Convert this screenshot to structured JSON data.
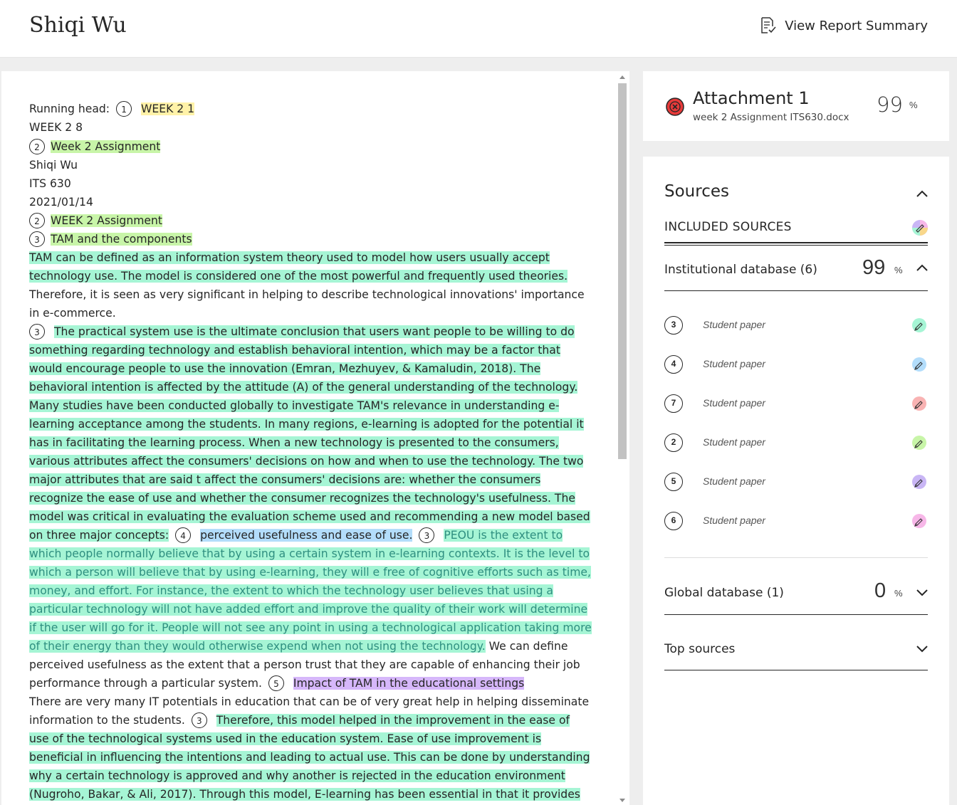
{
  "header": {
    "student_name": "Shiqi Wu",
    "report_button": "View Report Summary"
  },
  "document": {
    "line1_prefix": "Running head:",
    "line1_badge": "1",
    "line1_hl": "WEEK 2 1",
    "line2": "WEEK 2 8",
    "line3_badge": "2",
    "line3_hl": "Week 2 Assignment",
    "line4": "Shiqi Wu",
    "line5": "ITS 630",
    "line6": "2021/01/14",
    "line7_badge": "2",
    "line7_hl": "WEEK 2 Assignment",
    "line8_badge": "3",
    "line8_hl": "TAM and the components",
    "para1_hl": "TAM can be defined as an information system theory used to model how users usually accept technology use. The model is considered one of the most powerful and frequently used theories.",
    "para1_rest": " Therefore, it is seen as very significant in helping to describe technological innovations' importance in e-commerce.",
    "para2_badge": "3",
    "para2_hl": "The practical system use is the ultimate conclusion that users want people to be willing to do something regarding technology and establish behavioral intention, which may be a factor that would encourage people to use the innovation (Emran, Mezhuyev, & Kamaludin, 2018). The behavioral intention is affected by the attitude (A) of the general understanding of the technology. Many studies have been conducted globally to investigate TAM's relevance in understanding e-learning acceptance among the students. In many regions, e-learning is adopted for the potential it has in facilitating the learning process. When a new technology is presented to the consumers, various attributes affect the consumers' decisions on how and when to use the technology. The two major attributes that are said t affect the consumers' decisions are: whether the consumers recognize the ease of use and whether the consumer recognizes the technology's usefulness. The model was critical in evaluating the evaluation scheme used and recommending a new model based on three major concepts:",
    "para2_badge2": "4",
    "para2_blue": "perceived usefulness and ease of use.",
    "para2_badge3": "3",
    "para2_teal": "PEOU is the extent to which people normally believe that by using a certain system in e-learning contexts. It is the level to which a person will believe that by using e-learning, they will e free of cognitive efforts such as time, money, and effort. For instance, the extent to which the technology user believes that using a particular technology will not have added effort and improve the quality of their work will determine if the user will go for it. People will not see any point in using a technological application taking more of their energy than they would otherwise expend when not using the technology.",
    "para2_rest": " We can define perceived usefulness as the extent that a person trust that they are capable of enhancing their job performance through a particular system.",
    "para2_badge4": "5",
    "para2_purple": "Impact of TAM in the educational settings",
    "para3_text": "There are very many IT potentials in education that can be of very great help in helping disseminate information to the students.",
    "para3_badge": "3",
    "para3_hl": "Therefore, this model helped in the improvement in the ease of use of the technological systems used in the education system. Ease of use improvement is beneficial in influencing the intentions and leading to actual use. This can be done by understanding why a certain technology is approved and why another is rejected in the education environment (Nugroho, Bakar, & Ali, 2017). Through this model, E-learning has been essential in that it provides the students with flexibility and capability to learn from anywhere at any given time. Real-time training and skills evaluations allow"
  },
  "attachment": {
    "title": "Attachment 1",
    "filename": "week 2 Assignment ITS630.docx",
    "score": "99",
    "pct": "%"
  },
  "sources": {
    "heading": "Sources",
    "included_label": "INCLUDED SOURCES",
    "institutional": {
      "label": "Institutional database (6)",
      "score": "99",
      "pct": "%",
      "items": [
        {
          "num": "3",
          "name": "Student paper",
          "color": "#a6f5d5"
        },
        {
          "num": "4",
          "name": "Student paper",
          "color": "#b3ddfb"
        },
        {
          "num": "7",
          "name": "Student paper",
          "color": "#f9b3b3"
        },
        {
          "num": "2",
          "name": "Student paper",
          "color": "#c8f5a8"
        },
        {
          "num": "5",
          "name": "Student paper",
          "color": "#c9b6f5"
        },
        {
          "num": "6",
          "name": "Student paper",
          "color": "#f7b7e8"
        }
      ]
    },
    "global": {
      "label": "Global database (1)",
      "score": "0",
      "pct": "%"
    },
    "top": {
      "label": "Top sources"
    }
  }
}
